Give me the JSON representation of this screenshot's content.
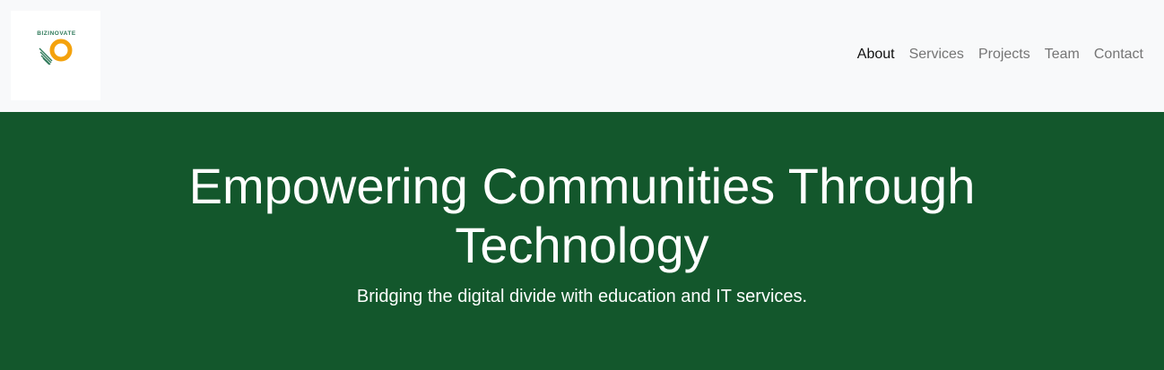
{
  "brand": {
    "logo_text": "BIZINOVATE",
    "logo_alt": "logo-icon",
    "colors": {
      "ring": "#f4a20c",
      "stripes": "#2f7a5a"
    }
  },
  "nav": {
    "items": [
      {
        "label": "About",
        "active": true
      },
      {
        "label": "Services",
        "active": false
      },
      {
        "label": "Projects",
        "active": false
      },
      {
        "label": "Team",
        "active": false
      },
      {
        "label": "Contact",
        "active": false
      }
    ]
  },
  "hero": {
    "title": "Empowering Communities Through Technology",
    "subtitle": "Bridging the digital divide with education and IT services.",
    "background": "#13572c"
  }
}
